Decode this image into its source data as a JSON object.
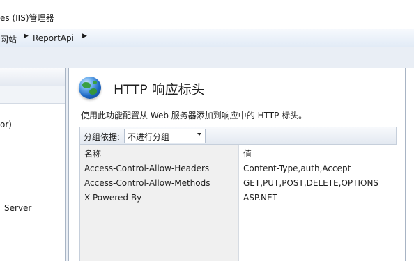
{
  "window": {
    "title": "es (IIS)管理器"
  },
  "breadcrumb": {
    "items": [
      "网站",
      "ReportApi"
    ]
  },
  "left_pane": {
    "items": [
      "or)",
      "Server"
    ]
  },
  "feature": {
    "icon": "globe-icon",
    "title": "HTTP 响应标头",
    "description": "使用此功能配置从 Web 服务器添加到响应中的 HTTP 标头。"
  },
  "group_by": {
    "label": "分组依据:",
    "selected": "不进行分组"
  },
  "table": {
    "columns": [
      "名称",
      "值"
    ],
    "rows": [
      {
        "name": "Access-Control-Allow-Headers",
        "value": "Content-Type,auth,Accept"
      },
      {
        "name": "Access-Control-Allow-Methods",
        "value": "GET,PUT,POST,DELETE,OPTIONS"
      },
      {
        "name": "X-Powered-By",
        "value": "ASP.NET"
      }
    ]
  },
  "colors": {
    "address_bar": "#e2ebf6",
    "name_column_bg": "#f0f0f0",
    "pane_border": "#a8b4c4"
  }
}
